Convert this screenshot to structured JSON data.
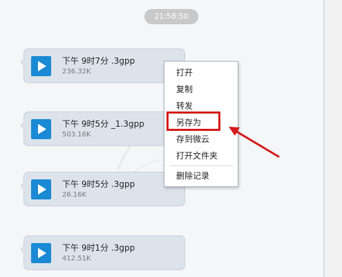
{
  "timestamp": "21:58:50",
  "messages": [
    {
      "name": "下午 9时7分 .3gpp",
      "size": "236.32K"
    },
    {
      "name": "下午 9时5分 _1.3gpp",
      "size": "503.16K"
    },
    {
      "name": "下午 9时5分 .3gpp",
      "size": "26.16K"
    },
    {
      "name": "下午 9时1分 .3gpp",
      "size": "412.51K"
    }
  ],
  "context_menu": {
    "items": [
      "打开",
      "复制",
      "转发",
      "另存为",
      "存到微云",
      "打开文件夹",
      "删除记录"
    ],
    "highlighted": "另存为"
  },
  "icons": {
    "play": "play-icon",
    "annotation": "red-arrow-icon"
  },
  "colors": {
    "accent": "#1a8ad4",
    "highlight": "#d41a1a",
    "bubble": "#dde3eb"
  }
}
